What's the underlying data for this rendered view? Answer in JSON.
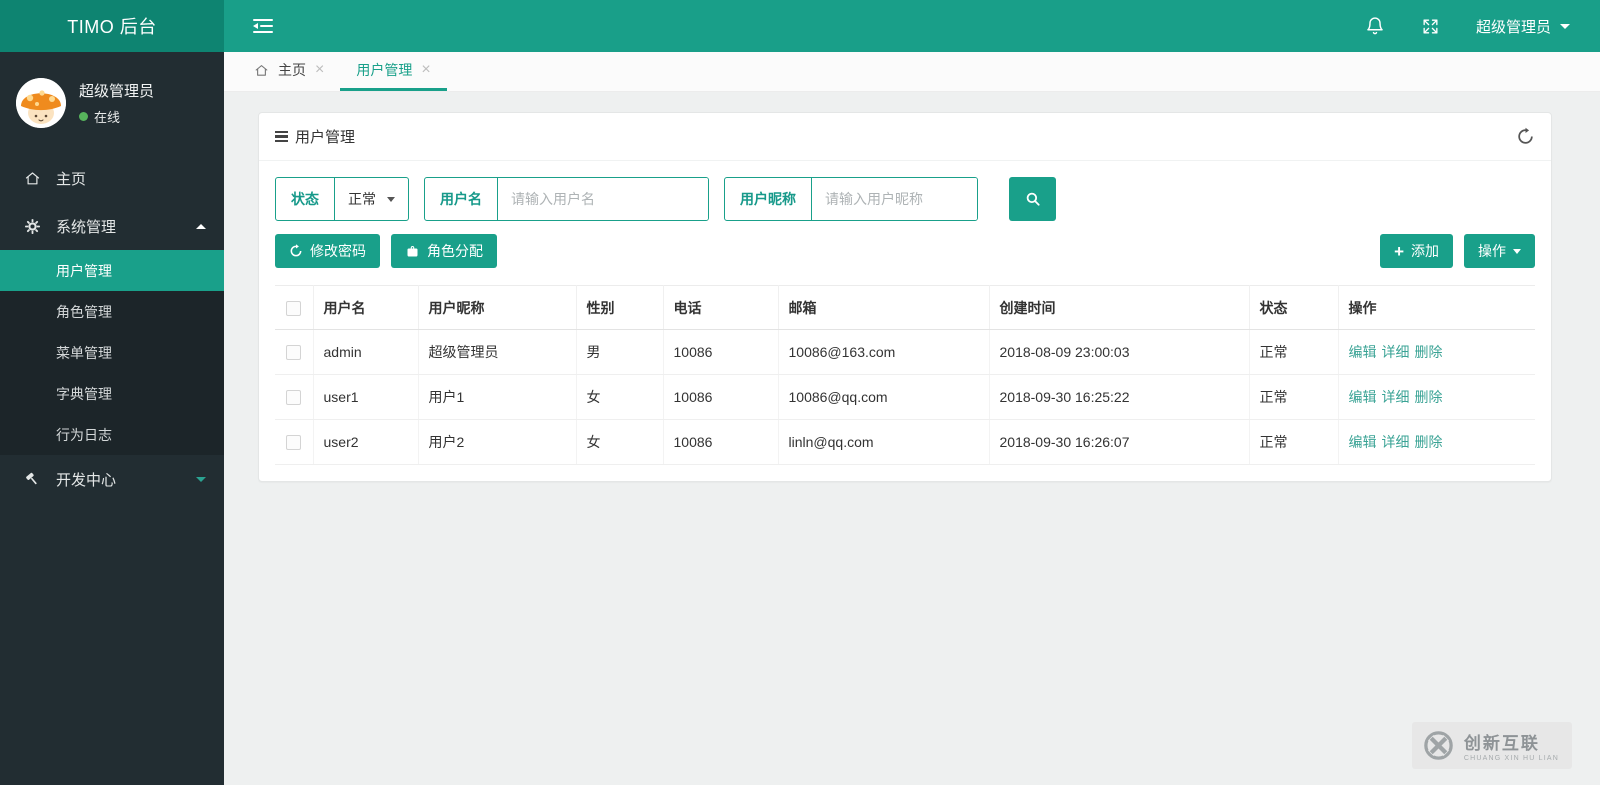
{
  "topbar": {
    "logo": "TIMO 后台",
    "user_menu": "超级管理员"
  },
  "sidebar": {
    "user": {
      "name": "超级管理员",
      "status": "在线"
    },
    "items": [
      {
        "label": "主页"
      },
      {
        "label": "系统管理"
      },
      {
        "label": "用户管理",
        "active": true
      },
      {
        "label": "角色管理"
      },
      {
        "label": "菜单管理"
      },
      {
        "label": "字典管理"
      },
      {
        "label": "行为日志"
      },
      {
        "label": "开发中心"
      }
    ]
  },
  "tabs": [
    {
      "label": "主页"
    },
    {
      "label": "用户管理",
      "active": true
    }
  ],
  "icons": {
    "close": "×",
    "plus": "+"
  },
  "panel": {
    "title": "用户管理",
    "filters": {
      "status_label": "状态",
      "status_value": "正常",
      "username_label": "用户名",
      "username_placeholder": "请输入用户名",
      "nickname_label": "用户昵称",
      "nickname_placeholder": "请输入用户昵称"
    },
    "toolbar": {
      "change_password": "修改密码",
      "assign_role": "角色分配",
      "add": "添加",
      "more": "操作"
    },
    "table": {
      "headers": [
        "用户名",
        "用户昵称",
        "性别",
        "电话",
        "邮箱",
        "创建时间",
        "状态",
        "操作"
      ],
      "action_labels": [
        "编辑",
        "详细",
        "删除"
      ],
      "rows": [
        {
          "username": "admin",
          "nickname": "超级管理员",
          "gender": "男",
          "phone": "10086",
          "email": "10086@163.com",
          "created": "2018-08-09 23:00:03",
          "status": "正常"
        },
        {
          "username": "user1",
          "nickname": "用户1",
          "gender": "女",
          "phone": "10086",
          "email": "10086@qq.com",
          "created": "2018-09-30 16:25:22",
          "status": "正常"
        },
        {
          "username": "user2",
          "nickname": "用户2",
          "gender": "女",
          "phone": "10086",
          "email": "linln@qq.com",
          "created": "2018-09-30 16:26:07",
          "status": "正常"
        }
      ]
    }
  },
  "watermark": {
    "name": "创新互联",
    "sub": "CHUANG XIN HU LIAN"
  },
  "colors": {
    "accent": "#19a08a",
    "logo_bg": "#0e8471",
    "sidebar_bg": "#222d32",
    "submenu_bg": "#1c2529",
    "online_green": "#57b45c",
    "link": "#3aa395"
  }
}
